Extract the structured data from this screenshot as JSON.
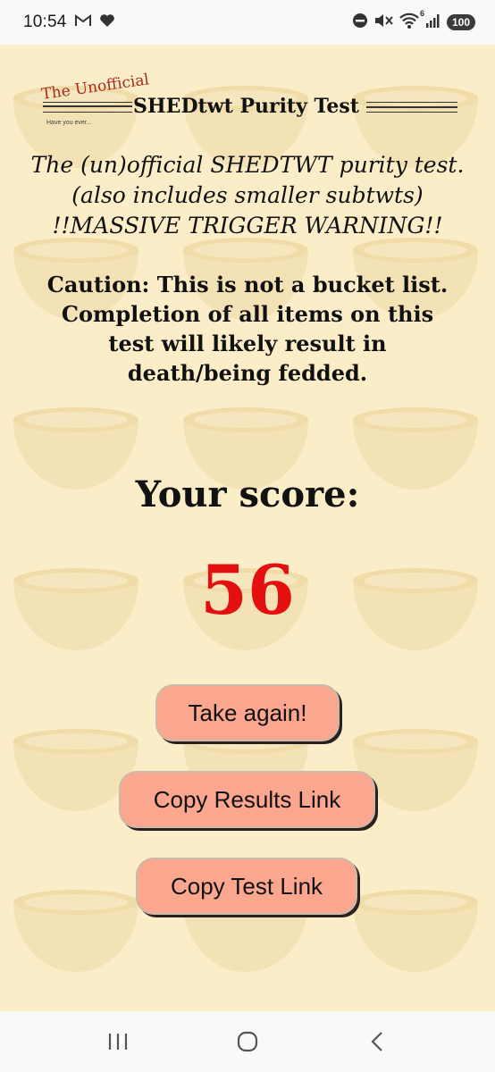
{
  "status_bar": {
    "time": "10:54",
    "battery": "100",
    "wifi_label": "6",
    "icons": [
      "gmail-icon",
      "heart-icon",
      "dnd-icon",
      "mute-icon",
      "wifi-icon",
      "signal-icon",
      "battery-icon"
    ]
  },
  "logo": {
    "small_text": "The Unofficial",
    "main_text": "SHEDtwt Purity Test",
    "tagline": "Have you ever..."
  },
  "intro": {
    "line1": "The (un)official SHEDTWT purity test.",
    "line2": "(also includes smaller subtwts)",
    "line3": "!!MASSIVE TRIGGER WARNING!!"
  },
  "caution": {
    "line1": "Caution: This is not a bucket list.",
    "line2": "Completion of all items on this",
    "line3": "test will likely result in",
    "line4": "death/being fedded."
  },
  "result": {
    "label": "Your score:",
    "score": "56"
  },
  "buttons": {
    "take_again": "Take again!",
    "copy_results": "Copy Results Link",
    "copy_test": "Copy Test Link"
  },
  "nav_bar": {
    "icons": [
      "recents-icon",
      "home-icon",
      "back-icon"
    ]
  },
  "colors": {
    "page_bg": "#fbedc7",
    "score": "#e4100f",
    "button": "#fba68f",
    "logo_accent": "#a32b1a"
  }
}
